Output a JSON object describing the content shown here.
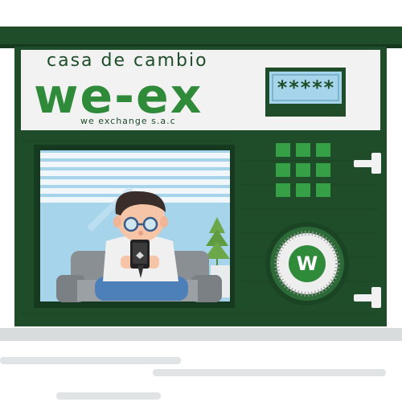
{
  "sign": {
    "subtitle": "casa de cambio",
    "brand": "we-ex",
    "company": "we exchange s.a.c"
  },
  "display": {
    "text": "*****"
  },
  "keypad": {
    "keys": [
      "key-1",
      "key-2",
      "key-3",
      "key-4",
      "key-5",
      "key-6",
      "key-7",
      "key-8",
      "key-9"
    ]
  },
  "dial": {
    "logo_letter": "W"
  },
  "colors": {
    "dark_green": "#1f4d2a",
    "brand_green": "#2f8a3a",
    "key_green": "#35a046",
    "sky": "#a6d4ea",
    "sofa": "#8a8f94",
    "white": "#f4f4f4"
  }
}
